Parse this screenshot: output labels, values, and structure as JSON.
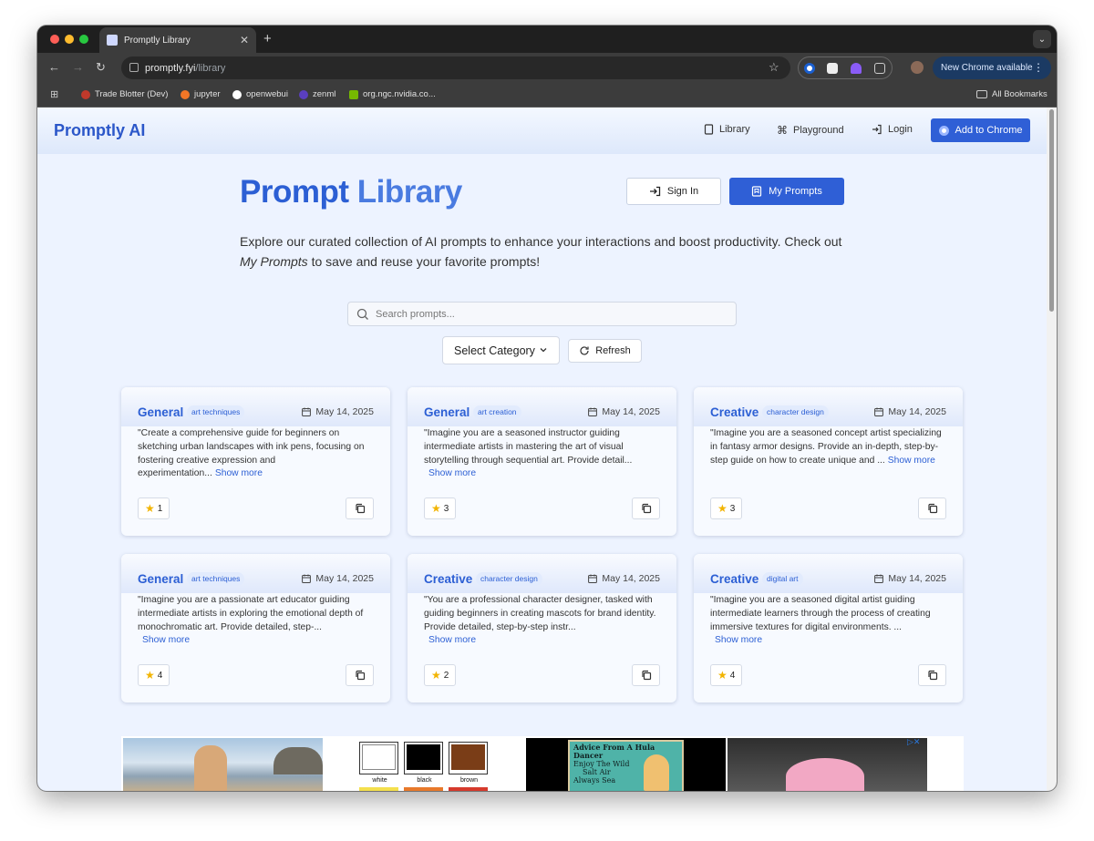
{
  "browser": {
    "tab_title": "Promptly Library",
    "url_domain": "promptly.fyi",
    "url_path": "/library",
    "update_label": "New Chrome available",
    "bookmarks": [
      "Trade Blotter (Dev)",
      "jupyter",
      "openwebui",
      "zenml",
      "org.ngc.nvidia.co..."
    ],
    "all_bookmarks": "All Bookmarks"
  },
  "header": {
    "brand": "Promptly AI",
    "nav": [
      "Library",
      "Playground",
      "Login"
    ],
    "add_to_chrome": "Add to Chrome"
  },
  "hero": {
    "title_part1": "Prompt",
    "title_part2": "Library",
    "sign_in": "Sign In",
    "my_prompts": "My Prompts",
    "intro_before": "Explore our curated collection of AI prompts to enhance your interactions and boost productivity. Check out ",
    "intro_em": "My Prompts",
    "intro_after": " to save and reuse your favorite prompts!"
  },
  "controls": {
    "search_placeholder": "Search prompts...",
    "category_select": "Select Category",
    "refresh": "Refresh"
  },
  "show_more": "Show more",
  "cards": [
    {
      "category": "General",
      "tag": "art techniques",
      "date": "May 14, 2025",
      "text": "\"Create a comprehensive guide for beginners on sketching urban landscapes with ink pens, focusing on fostering creative expression and experimentation...",
      "stars": "1"
    },
    {
      "category": "General",
      "tag": "art creation",
      "date": "May 14, 2025",
      "text": "\"Imagine you are a seasoned instructor guiding intermediate artists in mastering the art of visual storytelling through sequential art. Provide detail...",
      "stars": "3"
    },
    {
      "category": "Creative",
      "tag": "character design",
      "date": "May 14, 2025",
      "text": "\"Imagine you are a seasoned concept artist specializing in fantasy armor designs. Provide an in-depth, step-by-step guide on how to create unique and ...",
      "stars": "3"
    },
    {
      "category": "General",
      "tag": "art techniques",
      "date": "May 14, 2025",
      "text": "\"Imagine you are a passionate art educator guiding intermediate artists in exploring the emotional depth of monochromatic art. Provide detailed, step-...",
      "stars": "4"
    },
    {
      "category": "Creative",
      "tag": "character design",
      "date": "May 14, 2025",
      "text": "\"You are a professional character designer, tasked with guiding beginners in creating mascots for brand identity. Provide detailed, step-by-step instr...",
      "stars": "2"
    },
    {
      "category": "Creative",
      "tag": "digital art",
      "date": "May 14, 2025",
      "text": "\"Imagine you are a seasoned digital artist guiding intermediate learners through the process of creating immersive textures for digital environments. ...",
      "stars": "4"
    }
  ],
  "ads": {
    "swatches": [
      "white",
      "black",
      "brown"
    ],
    "hula_text": [
      "Advice From A Hula Dancer",
      "Enjoy The Wild",
      "Salt Air",
      "Always Sea"
    ]
  }
}
